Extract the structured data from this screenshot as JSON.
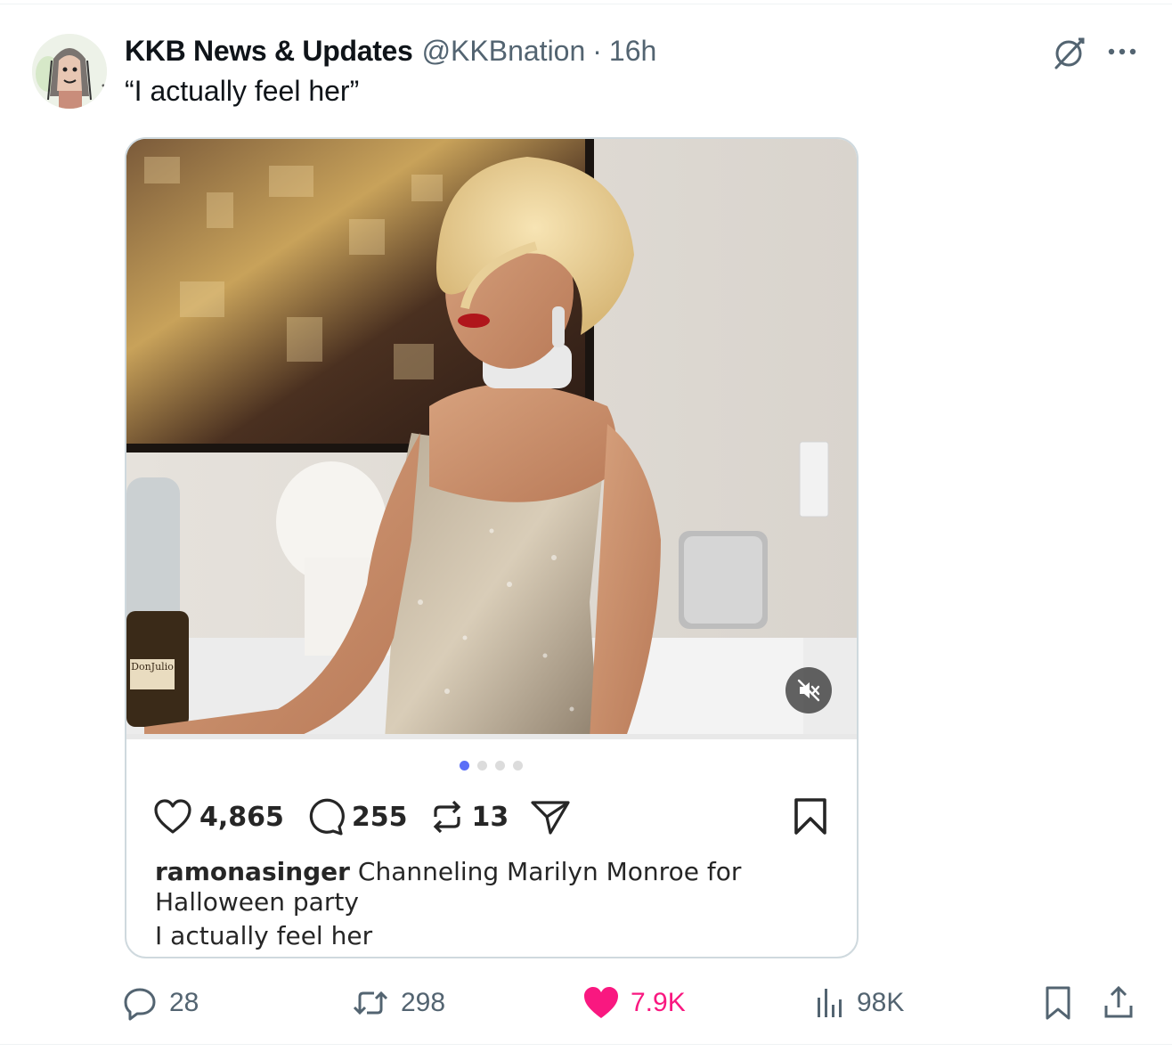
{
  "tweet": {
    "display_name": "KKB News & Updates",
    "handle": "@KKBnation",
    "separator": "·",
    "time": "16h",
    "text": "“I actually feel her”"
  },
  "embedded_post": {
    "carousel": {
      "count": 4,
      "active_index": 0,
      "active_color": "#5b6ff7"
    },
    "likes": "4,865",
    "comments": "255",
    "reposts": "13",
    "caption_user": "ramonasinger",
    "caption_text": "Channeling Marilyn Monroe for Halloween party",
    "caption_line2": "I actually feel her",
    "photo_brand_label": "DonJulio"
  },
  "actions": {
    "replies": "28",
    "retweets": "298",
    "likes": "7.9K",
    "views": "98K"
  },
  "colors": {
    "text_primary": "#0f1419",
    "text_secondary": "#536471",
    "like_pink": "#f91880",
    "border": "#cfd9de"
  },
  "icons": [
    "grok-icon",
    "more-icon",
    "mute-icon",
    "heart-icon",
    "comment-icon",
    "repost-icon",
    "send-icon",
    "bookmark-icon",
    "reply-icon",
    "retweet-icon",
    "like-icon",
    "views-icon",
    "share-icon"
  ]
}
